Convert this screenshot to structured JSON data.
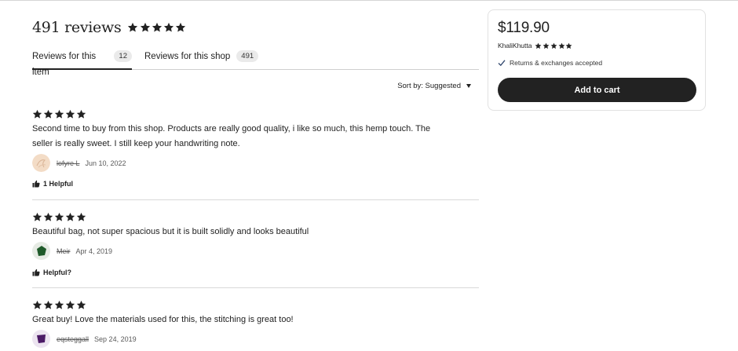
{
  "summary": {
    "count_text": "491 reviews",
    "rating": 5
  },
  "tabs": [
    {
      "label": "Reviews for this item",
      "count": "12",
      "active": true
    },
    {
      "label": "Reviews for this shop",
      "count": "491",
      "active": false
    }
  ],
  "sort": {
    "label": "Sort by: Suggested"
  },
  "reviews": [
    {
      "rating": 5,
      "text": "Second time to buy from this shop. Products are really good quality, i like so much, this hemp touch. The seller is really sweet. I still keep your handwriting note.",
      "user": "lofyre L",
      "date": "Jun 10, 2022",
      "avatar_color": "#f3dcc6",
      "helpful": "1 Helpful"
    },
    {
      "rating": 5,
      "text": "Beautiful bag, not super spacious but it is built solidly and looks beautiful",
      "user": "Meir",
      "date": "Apr 4, 2019",
      "avatar_color": "#1f5a2a",
      "helpful": "Helpful?"
    },
    {
      "rating": 5,
      "text": "Great buy! Love the materials used for this, the stitching is great too!",
      "user": "eqsteggall",
      "date": "Sep 24, 2019",
      "avatar_color": "#4b1a66",
      "helpful": ""
    }
  ],
  "buy_box": {
    "price": "$119.90",
    "seller": "KhaliKhutta",
    "seller_rating": 5,
    "returns": "Returns & exchanges accepted",
    "cart_button": "Add to cart"
  },
  "colors": {
    "text": "#222222",
    "button": "#222222",
    "check": "#2f466c"
  },
  "icons": {
    "star": "star-icon",
    "check": "check-icon",
    "thumb": "thumbs-up-icon",
    "caret": "caret-down-icon"
  }
}
